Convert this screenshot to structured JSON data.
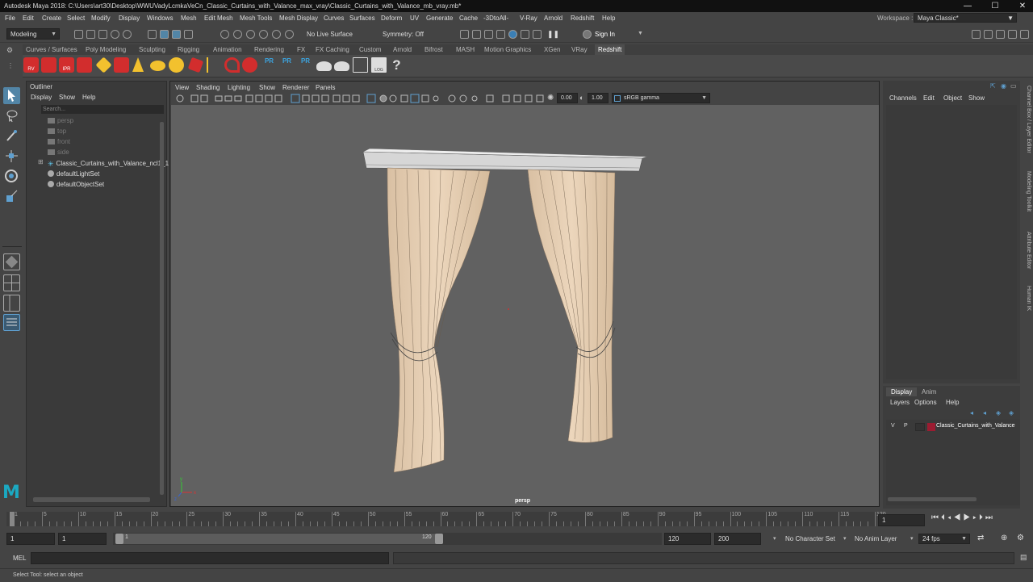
{
  "titlebar": {
    "title": "Autodesk Maya 2018: C:\\Users\\art30\\Desktop\\WWUVadyLcmkaVeCn_Classic_Curtains_with_Valance_max_vray\\Classic_Curtains_with_Valance_mb_vray.mb*",
    "minimize": "—",
    "maximize": "☐",
    "close": "✕"
  },
  "menubar": [
    "File",
    "Edit",
    "Create",
    "Select",
    "Modify",
    "Display",
    "Windows",
    "Mesh",
    "Edit Mesh",
    "Mesh Tools",
    "Mesh Display",
    "Curves",
    "Surfaces",
    "Deform",
    "UV",
    "Generate",
    "Cache",
    "-3DtoAll-",
    "V-Ray",
    "Arnold",
    "Redshift",
    "Help"
  ],
  "workspace": {
    "label": "Workspace :",
    "value": "Maya Classic*"
  },
  "toolbar": {
    "mode": "Modeling",
    "live_surface": "No Live Surface",
    "symmetry": "Symmetry: Off",
    "sign_in": "Sign In"
  },
  "shelf_tabs": [
    "Curves / Surfaces",
    "Poly Modeling",
    "Sculpting",
    "Rigging",
    "Animation",
    "Rendering",
    "FX",
    "FX Caching",
    "Custom",
    "Arnold",
    "Bifrost",
    "MASH",
    "Motion Graphics",
    "XGen",
    "VRay",
    "Redshift"
  ],
  "shelf_active_tab": "Redshift",
  "shelf_icon_labels": {
    "rv": "RV",
    "ipr": "IPR",
    "pr": "PR",
    "log": "LOG",
    "help": "?"
  },
  "outliner": {
    "title": "Outliner",
    "menu": [
      "Display",
      "Show",
      "Help"
    ],
    "search_placeholder": "Search...",
    "items": [
      {
        "label": "persp",
        "dim": true
      },
      {
        "label": "top",
        "dim": true
      },
      {
        "label": "front",
        "dim": true
      },
      {
        "label": "side",
        "dim": true
      },
      {
        "label": "Classic_Curtains_with_Valance_ncl1_1",
        "dim": false
      },
      {
        "label": "defaultLightSet",
        "dim": false
      },
      {
        "label": "defaultObjectSet",
        "dim": false
      }
    ],
    "expand_glyph": "⊞"
  },
  "viewport": {
    "menu": [
      "View",
      "Shading",
      "Lighting",
      "Show",
      "Renderer",
      "Panels"
    ],
    "exposure": "0.00",
    "gamma": "1.00",
    "color_space": "sRGB gamma",
    "camera_label": "persp",
    "axis": {
      "x": "x",
      "y": "y",
      "z": "z"
    }
  },
  "channelbox": {
    "menu": [
      "Channels",
      "Edit",
      "Object",
      "Show"
    ]
  },
  "side_tabs": [
    "Channel Box / Layer Editor",
    "Modeling Toolkit",
    "Attribute Editor",
    "Human IK"
  ],
  "layer_editor": {
    "tabs": [
      "Display",
      "Anim"
    ],
    "menu": [
      "Layers",
      "Options",
      "Help"
    ],
    "layer": {
      "v": "V",
      "p": "P",
      "name": "Classic_Curtains_with_Valance",
      "color": "#9b1c31"
    }
  },
  "timeline": {
    "ticks": [
      1,
      5,
      10,
      15,
      20,
      25,
      30,
      35,
      40,
      45,
      50,
      55,
      60,
      65,
      70,
      75,
      80,
      85,
      90,
      95,
      100,
      105,
      110,
      115,
      120
    ],
    "current_frame": "1"
  },
  "range": {
    "start": "1",
    "playback_start": "1",
    "slider_start": "1",
    "slider_end": "120",
    "playback_end": "120",
    "end": "200",
    "character_set": "No Character Set",
    "anim_layer": "No Anim Layer",
    "fps": "24 fps"
  },
  "cmdline": {
    "label": "MEL"
  },
  "help_line": "Select Tool: select an object",
  "logo": "M",
  "colors": {
    "accent": "#5285a6",
    "maya_logo": "#1ba9c2",
    "curtain": "#e6cfb4",
    "redshift": "#d22d2d"
  }
}
